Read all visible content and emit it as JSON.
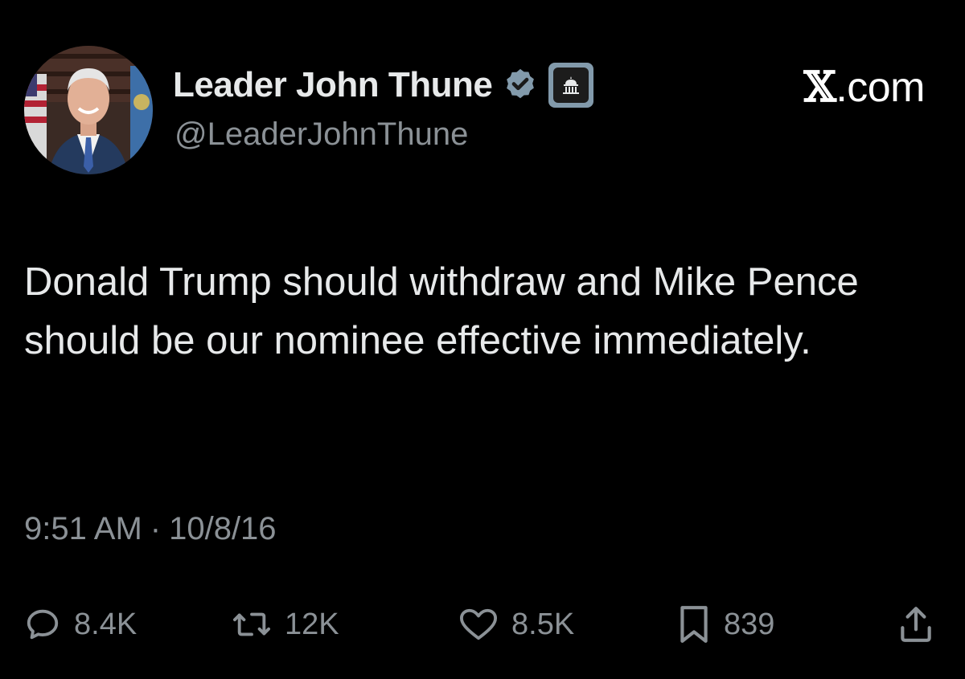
{
  "author": {
    "display_name": "Leader John Thune",
    "handle": "@LeaderJohnThune",
    "verified_icon": "verified-badge-icon",
    "affiliation_icon": "capitol-building-icon"
  },
  "brand": {
    "x_glyph": "𝕏",
    "suffix": ".com"
  },
  "tweet": {
    "text": "Donald Trump should withdraw and Mike Pence should be our nominee effective immediately.",
    "time": "9:51 AM",
    "separator": "·",
    "date": "10/8/16"
  },
  "engagement": {
    "replies": "8.4K",
    "retweets": "12K",
    "likes": "8.5K",
    "bookmarks": "839"
  },
  "colors": {
    "background": "#000000",
    "text_primary": "#e7e9ea",
    "text_secondary": "#8b9196",
    "verified": "#829aab"
  }
}
